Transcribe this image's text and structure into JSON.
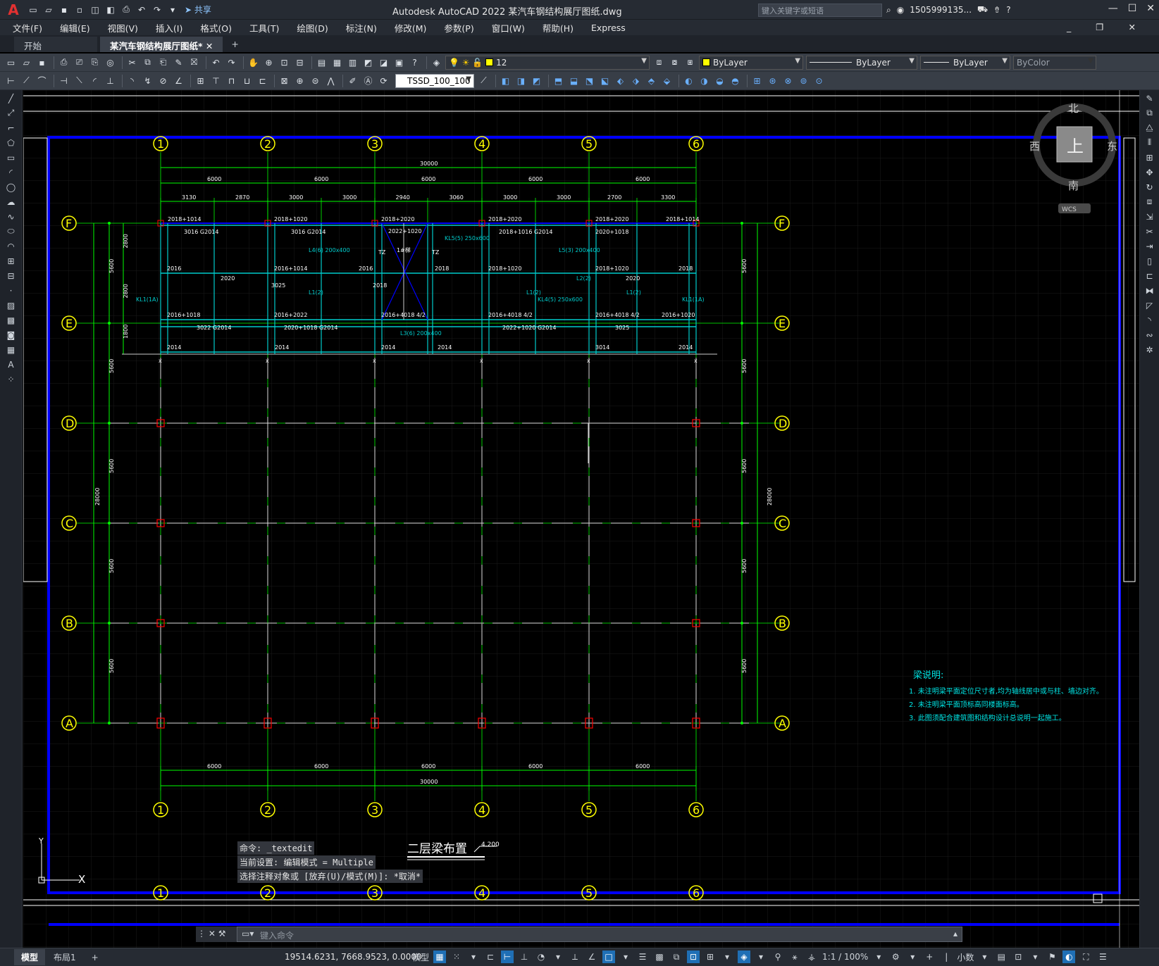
{
  "app": {
    "logo": "A",
    "title": "Autodesk AutoCAD 2022    某汽车钢结构展厅图纸.dwg",
    "share": "共享",
    "search_placeholder": "键入关键字或短语",
    "user": "1505999135...",
    "help": "?"
  },
  "menu": [
    "文件(F)",
    "编辑(E)",
    "视图(V)",
    "插入(I)",
    "格式(O)",
    "工具(T)",
    "绘图(D)",
    "标注(N)",
    "修改(M)",
    "参数(P)",
    "窗口(W)",
    "帮助(H)",
    "Express"
  ],
  "tabs": [
    {
      "label": "开始",
      "active": false
    },
    {
      "label": "某汽车钢结构展厅图纸*",
      "active": true
    }
  ],
  "toolbar": {
    "layer_value": "12",
    "color_value": "ByLayer",
    "linetype_value": "ByLayer",
    "lineweight_value": "ByLayer",
    "plotstyle_value": "ByColor",
    "dimstyle_value": "TSSD_100_100",
    "layer_color": "#ffff00"
  },
  "viewcube": {
    "north": "北",
    "south": "南",
    "west": "西",
    "east": "东",
    "face": "上",
    "wcs": "WCS"
  },
  "drawing": {
    "grid_cols": [
      "1",
      "2",
      "3",
      "4",
      "5",
      "6"
    ],
    "grid_rows": [
      "F",
      "E",
      "D",
      "C",
      "B",
      "A"
    ],
    "dim_total": "30000",
    "dim_spans": [
      "6000",
      "6000",
      "6000",
      "6000",
      "6000"
    ],
    "dim_sub": [
      "3130",
      "2870",
      "3000",
      "3000",
      "2940",
      "3060",
      "3000",
      "3000",
      "2700",
      "3300"
    ],
    "dim_rows_left": [
      "5600",
      "5600",
      "5600",
      "5600",
      "5600"
    ],
    "dim_rows_right": [
      "5600",
      "5600",
      "5600",
      "5600",
      "5600"
    ],
    "dim_sub_left": [
      "2800",
      "2800",
      "1800"
    ],
    "dim_total_left": "28000",
    "dim_total_right": "28000",
    "beam_labels": [
      "2018+1014",
      "2018+1020",
      "2018+2020",
      "2018+2020",
      "2018+2020",
      "2018+1014",
      "2022+1020",
      "2016+1014",
      "2016",
      "2016",
      "2018",
      "2018+1020",
      "2018+1020",
      "2018",
      "2016+1018",
      "2016+2022",
      "2016+4018 4/2",
      "2016+4018 4/2",
      "2016+4018 4/2",
      "2016+1020",
      "2014",
      "2014",
      "2014",
      "2014",
      "3014",
      "2014",
      "1#梯",
      "KL5(5) 250x600",
      "KL4(5) 250x600",
      "L4(6) 200x400",
      "L5(3) 200x400",
      "L3(6) 200x400",
      "3016 G2014",
      "3016 G2014",
      "2018+1016 G2014",
      "2020+1018",
      "2022+1020 G2014",
      "3022 G2014",
      "2020+1018 G2014",
      "3025",
      "3025",
      "2020",
      "2018",
      "2020",
      "L1(2)",
      "L1(2)",
      "L1(2)",
      "L2(2)",
      "KL1(1A)",
      "KL1(1A)",
      "TZ",
      "TZ"
    ],
    "plan_title": "二层梁布置",
    "elevation": "4.200",
    "notes_title": "梁说明:",
    "notes": [
      "1. 未注明梁平面定位尺寸者,均为轴线居中或与柱、墙边对齐。",
      "2. 未注明梁平面顶标高同楼面标高。",
      "3. 此图须配合建筑图和结构设计总说明一起施工。"
    ],
    "ucs_y": "Y",
    "ucs_x": "X"
  },
  "command": {
    "history": [
      "命令: _textedit",
      "当前设置: 编辑模式 = Multiple",
      "选择注释对象或 [放弃(U)/模式(M)]: *取消*"
    ],
    "placeholder": "键入命令"
  },
  "status": {
    "model_tab": "模型",
    "layout_tab": "布局1",
    "add_tab": "+",
    "coords": "19514.6231, 7668.9523, 0.0000",
    "model_label": "模型",
    "scale": "1:1 / 100%",
    "units": "小数"
  },
  "colors": {
    "grid_line": "#00ff00",
    "grid_bubble": "#ffff00",
    "beam": "#00cccc",
    "frame": "#0000ff",
    "dim": "#00ff00",
    "column": "#ff0000",
    "text": "#ffffff"
  }
}
